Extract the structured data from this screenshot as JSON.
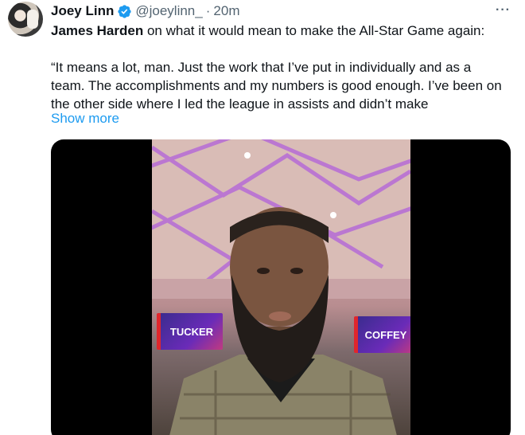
{
  "author": {
    "name": "Joey Linn",
    "handle": "@joeylinn_",
    "separator": "·",
    "time": "20m"
  },
  "icons": {
    "verified": "verified-badge-icon",
    "more": "more-options-icon",
    "verified_color": "#1d9bf0"
  },
  "more_label": "···",
  "tweet": {
    "mention": "James Harden",
    "line1_rest": " on what it would mean to make the All-Star Game again:",
    "quote_line1": "“It means a lot, man. Just the work that I’ve put in individually and as a",
    "quote_line2": "team. The  accomplishments and my numbers is good enough. I’ve been on",
    "quote_line3": "the other side where I led the league in assists and didn’t make",
    "show_more": "Show more"
  },
  "media": {
    "sign_left": "TUCKER",
    "sign_right": "COFFEY"
  }
}
